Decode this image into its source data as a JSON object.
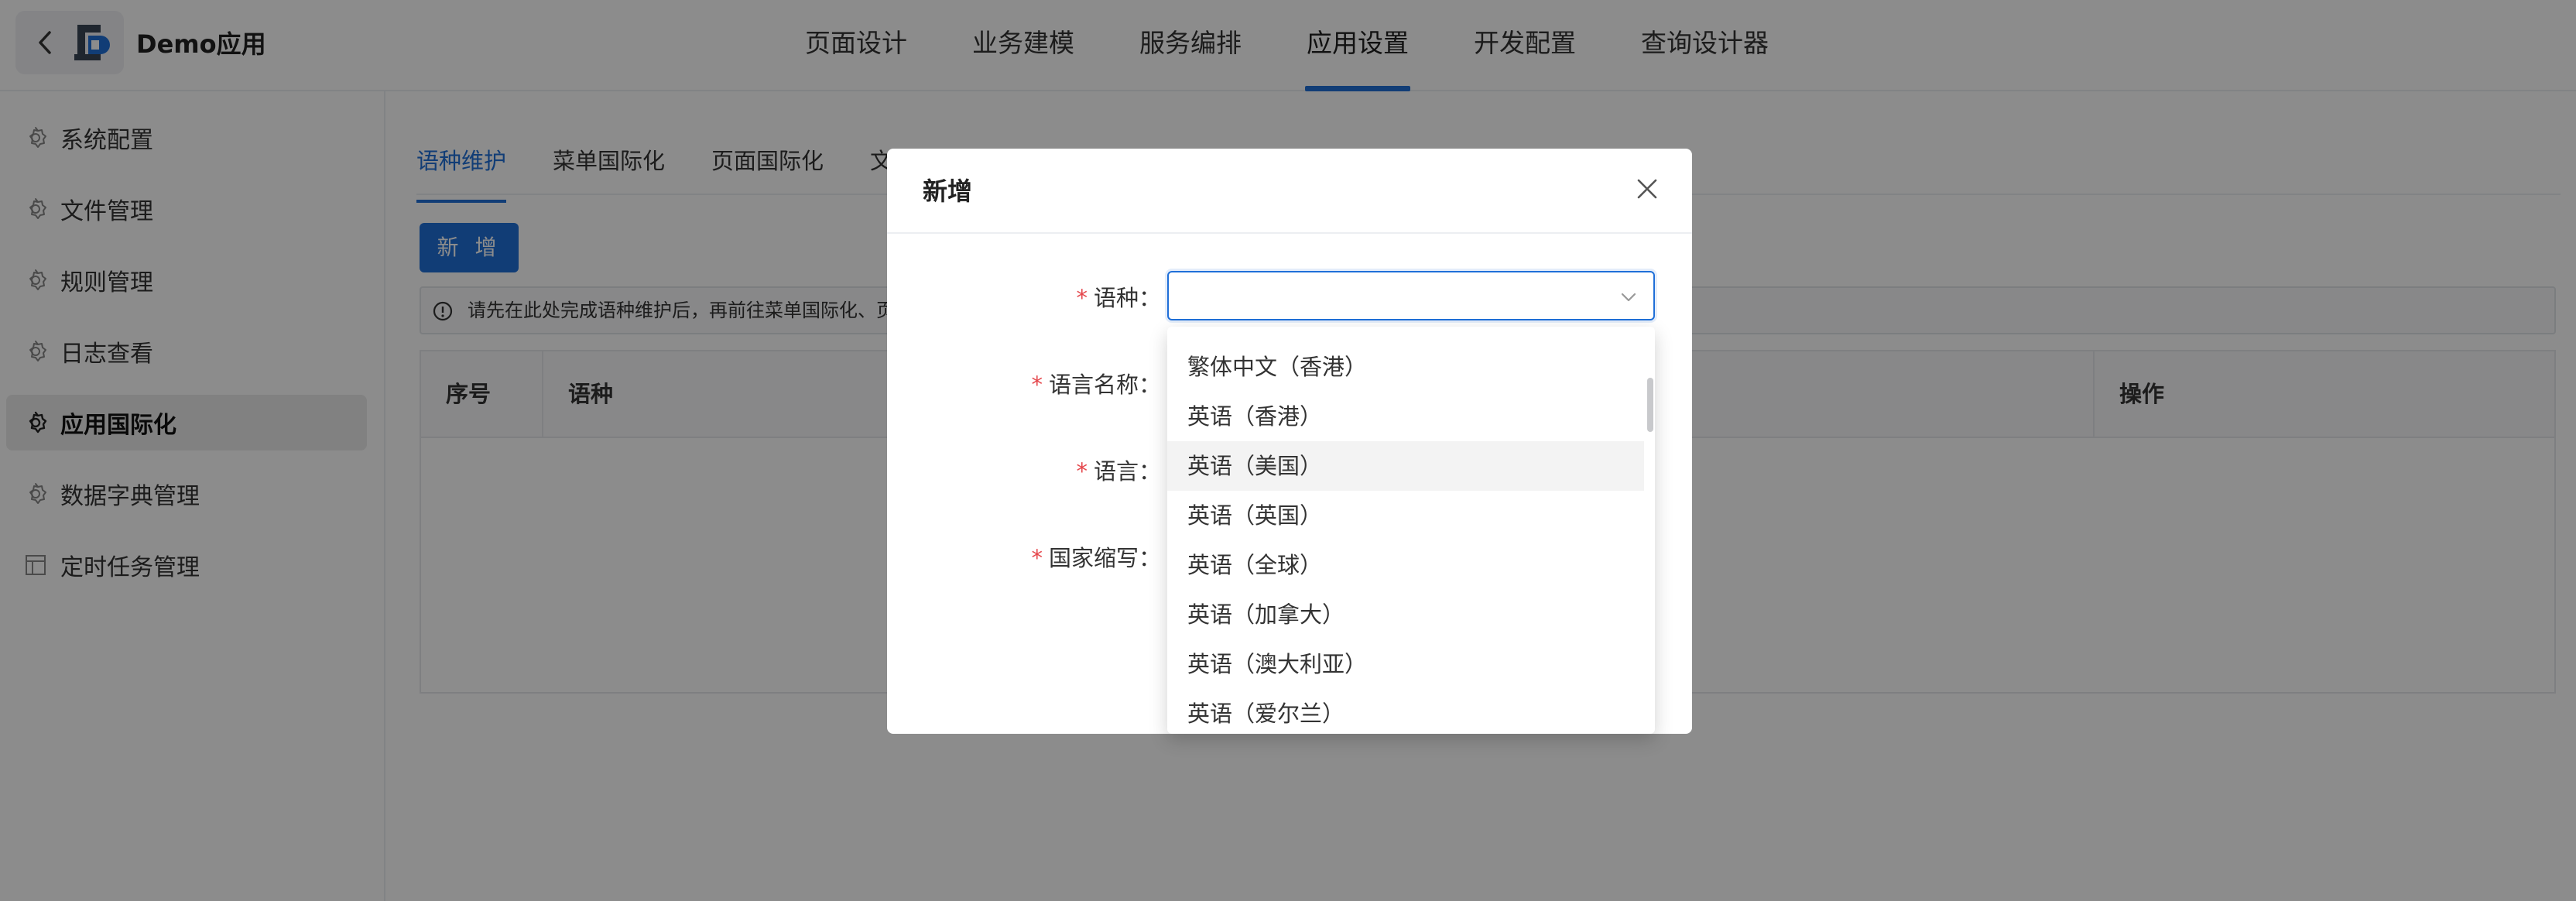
{
  "app": {
    "title": "Demo应用"
  },
  "top_nav": [
    "页面设计",
    "业务建模",
    "服务编排",
    "应用设置",
    "开发配置",
    "查询设计器"
  ],
  "top_nav_active": "应用设置",
  "sidebar": {
    "items": [
      {
        "label": "系统配置",
        "icon": "gear-icon"
      },
      {
        "label": "文件管理",
        "icon": "gear-icon"
      },
      {
        "label": "规则管理",
        "icon": "gear-icon"
      },
      {
        "label": "日志查看",
        "icon": "gear-icon"
      },
      {
        "label": "应用国际化",
        "icon": "gear-icon",
        "active": true
      },
      {
        "label": "数据字典管理",
        "icon": "gear-icon"
      },
      {
        "label": "定时任务管理",
        "icon": "layout-icon"
      }
    ]
  },
  "main": {
    "tabs": [
      "语种维护",
      "菜单国际化",
      "页面国际化",
      "文"
    ],
    "new_button": "新 增",
    "notice": "请先在此处完成语种维护后，再前往菜单国际化、页",
    "table_headers": {
      "index": "序号",
      "language": "语种",
      "actions": "操作"
    }
  },
  "modal": {
    "title": "新增",
    "fields": {
      "language_kind": "语种：",
      "language_name": "语言名称：",
      "language": "语言：",
      "country_abbr": "国家缩写："
    },
    "required_mark": "*",
    "select_value": "",
    "dropdown_options": [
      "繁体中文（香港）",
      "英语（香港）",
      "英语（美国）",
      "英语（英国）",
      "英语（全球）",
      "英语（加拿大）",
      "英语（澳大利亚）",
      "英语（爱尔兰）"
    ],
    "hovered_option": "英语（美国）"
  },
  "colors": {
    "accent": "#1f6fd8",
    "required": "#e5484d",
    "overlay": "rgba(0,0,0,0.45)"
  }
}
